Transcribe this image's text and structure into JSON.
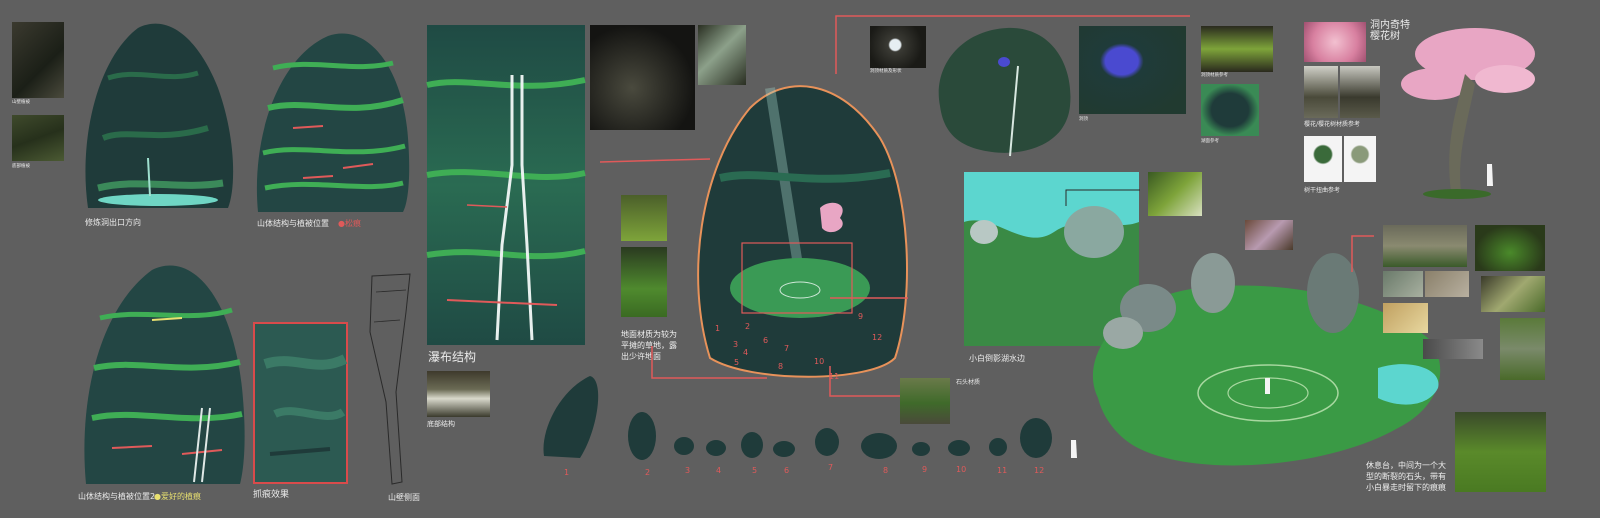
{
  "labels": {
    "mountain_veg": "山壁植被",
    "bottom_veg": "底部植被",
    "exit_dir": "修炼洞出口方向",
    "structure_veg": "山体结构与植被位置",
    "moss_tag": "●松痕",
    "structure_veg2": "山体结构与植被位置2",
    "scratch_tag": "●爱好的植痕",
    "scratch_effect": "抓痕效果",
    "wall_side": "山壁侧面",
    "waterfall_structure": "瀑布结构",
    "bottom_structure": "底部结构",
    "ground_material": "地面材质为较为平摊的草地，露出少许地面",
    "cave_hole_shape": "洞顶材质及形状",
    "lake_side": "小白倒影湖水边",
    "stone_material": "石头材质",
    "lake_note": "洞顶",
    "cherry_title": "洞内奇特樱花树",
    "cherry_ref": "樱花/樱花树材质参考",
    "bonsai_ref": "树干扭曲参考",
    "rest_area": "休息台，中间为一个大型的断裂的石头，带有小白暴走时留下的痕痕",
    "tiny_ref1": "洞顶材质参考",
    "tiny_ref2": "湖面参考"
  },
  "stone_numbers": [
    "1",
    "2",
    "3",
    "4",
    "5",
    "6",
    "7",
    "8",
    "9",
    "10",
    "11",
    "12"
  ],
  "colors": {
    "background": "#5f5f5f",
    "accent_red": "#e05a5a",
    "moss_green": "#3fae55",
    "dark_teal": "#1f3b3a",
    "cherry_pink": "#e8a6c4",
    "lake_cyan": "#5cd6cf"
  }
}
